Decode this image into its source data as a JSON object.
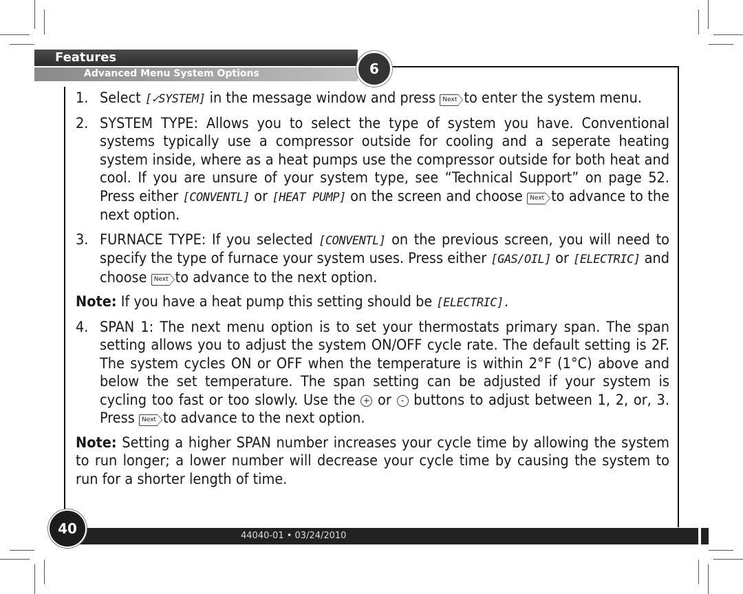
{
  "header": {
    "section": "Features",
    "subsection": "Advanced Menu System Options",
    "chapter_number": "6"
  },
  "items": [
    {
      "number": "1.",
      "parts": [
        {
          "t": "text",
          "v": "Select "
        },
        {
          "t": "lcd",
          "v": "[✓SYSTEM]"
        },
        {
          "t": "text",
          "v": " in the message window and press "
        },
        {
          "t": "next",
          "v": "Next"
        },
        {
          "t": "text",
          "v": "to enter the system menu."
        }
      ]
    },
    {
      "number": "2.",
      "parts": [
        {
          "t": "text",
          "v": "SYSTEM TYPE: Allows you to select the type of system you have. Conventional systems typically use a compressor outside for cooling and a seperate heating system inside, where as a heat pumps use the compressor outside for both heat and cool. If you are unsure of your system type, see “Technical Support” on page 52. Press either "
        },
        {
          "t": "lcd",
          "v": "[CONVENTL]"
        },
        {
          "t": "text",
          "v": " or "
        },
        {
          "t": "lcd",
          "v": "[HEAT PUMP]"
        },
        {
          "t": "text",
          "v": " on the screen and choose "
        },
        {
          "t": "next",
          "v": "Next"
        },
        {
          "t": "text",
          "v": "to advance to the next option."
        }
      ]
    },
    {
      "number": "3.",
      "parts": [
        {
          "t": "text",
          "v": "FURNACE TYPE: If you selected "
        },
        {
          "t": "lcd",
          "v": "[CONVENTL]"
        },
        {
          "t": "text",
          "v": " on the previous screen, you will need to specify the type of furnace your system uses. Press either "
        },
        {
          "t": "lcd",
          "v": "[GAS/OIL]"
        },
        {
          "t": "text",
          "v": " or "
        },
        {
          "t": "lcd",
          "v": "[ELECTRIC]"
        },
        {
          "t": "text",
          "v": " and choose "
        },
        {
          "t": "next",
          "v": "Next"
        },
        {
          "t": "text",
          "v": "to advance to the next option."
        }
      ]
    }
  ],
  "note1": {
    "label": "Note:",
    "parts": [
      {
        "t": "text",
        "v": " If you have a heat pump this setting should be "
      },
      {
        "t": "lcd",
        "v": "[ELECTRIC]."
      }
    ]
  },
  "item4": {
    "number": "4.",
    "parts": [
      {
        "t": "text",
        "v": "SPAN 1: The next menu option is to set your thermostats primary span. The span setting allows you to adjust the system ON/OFF cycle rate. The default setting is 2F. The system cycles ON or OFF when the temperature is within 2°F (1°C) above and below the set temperature. The span setting can be adjusted if your system is cycling too fast or too slowly. Use the "
      },
      {
        "t": "round",
        "v": "+"
      },
      {
        "t": "text",
        "v": " or "
      },
      {
        "t": "round",
        "v": "-"
      },
      {
        "t": "text",
        "v": " buttons to adjust between 1, 2, or, 3. Press "
      },
      {
        "t": "next",
        "v": "Next"
      },
      {
        "t": "text",
        "v": "to advance to the next option."
      }
    ]
  },
  "note2": {
    "label": "Note:",
    "parts": [
      {
        "t": "text",
        "v": " Setting a higher SPAN number increases your cycle time by allowing the system to run longer; a lower number will decrease your cycle time by causing the system to run for a shorter length of time."
      }
    ]
  },
  "footer": {
    "page_number": "40",
    "doc_code": "44040-01 • 03/24/2010"
  }
}
